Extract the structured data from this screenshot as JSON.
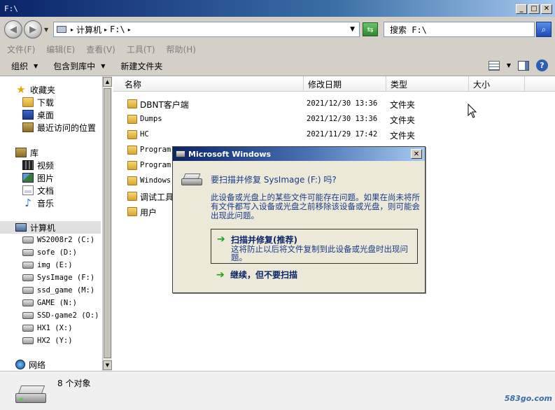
{
  "window": {
    "title": "F:\\",
    "min_label": "_",
    "max_label": "□",
    "close_label": "✕"
  },
  "address": {
    "crumb_computer": "计算机",
    "crumb_drive": "F:\\",
    "search_placeholder": "搜索 F:\\"
  },
  "menu": [
    "文件(F)",
    "编辑(E)",
    "查看(V)",
    "工具(T)",
    "帮助(H)"
  ],
  "commands": {
    "organize": "组织",
    "include_library": "包含到库中",
    "new_folder": "新建文件夹"
  },
  "nav": {
    "favorites": "收藏夹",
    "downloads": "下载",
    "desktop": "桌面",
    "recent": "最近访问的位置",
    "libraries": "库",
    "videos": "视频",
    "pictures": "图片",
    "documents": "文档",
    "music": "音乐",
    "computer": "计算机",
    "drives": [
      "WS2008r2 (C:)",
      "sofe (D:)",
      "img (E:)",
      "SysImage (F:)",
      "ssd_game (M:)",
      "GAME (N:)",
      "SSD-game2 (O:)",
      "HX1 (X:)",
      "HX2 (Y:)"
    ],
    "network": "网络"
  },
  "columns": {
    "name": "名称",
    "date": "修改日期",
    "type": "类型",
    "size": "大小"
  },
  "files": [
    {
      "name": "DBNT客户端",
      "date": "2021/12/30 13:36",
      "type": "文件夹"
    },
    {
      "name": "Dumps",
      "date": "2021/12/30 13:36",
      "type": "文件夹"
    },
    {
      "name": "HC",
      "date": "2021/11/29 17:42",
      "type": "文件夹"
    },
    {
      "name": "Program",
      "date": "",
      "type": ""
    },
    {
      "name": "Program",
      "date": "",
      "type": ""
    },
    {
      "name": "Windows",
      "date": "",
      "type": ""
    },
    {
      "name": "调试工具",
      "date": "",
      "type": ""
    },
    {
      "name": "用户",
      "date": "",
      "type": ""
    }
  ],
  "status": {
    "count": "8 个对象",
    "watermark": "583go.com"
  },
  "dialog": {
    "title": "Microsoft Windows",
    "heading": "要扫描并修复 SysImage (F:) 吗?",
    "body": "此设备或光盘上的某些文件可能存在问题。如果在尚未将所有文件都写入设备或光盘之前移除该设备或光盘，则可能会出现此问题。",
    "option1_title": "扫描并修复(推荐)",
    "option1_desc": "这将防止以后将文件复制到此设备或光盘时出现问题。",
    "option2_title": "继续，但不要扫描",
    "close_label": "✕"
  }
}
